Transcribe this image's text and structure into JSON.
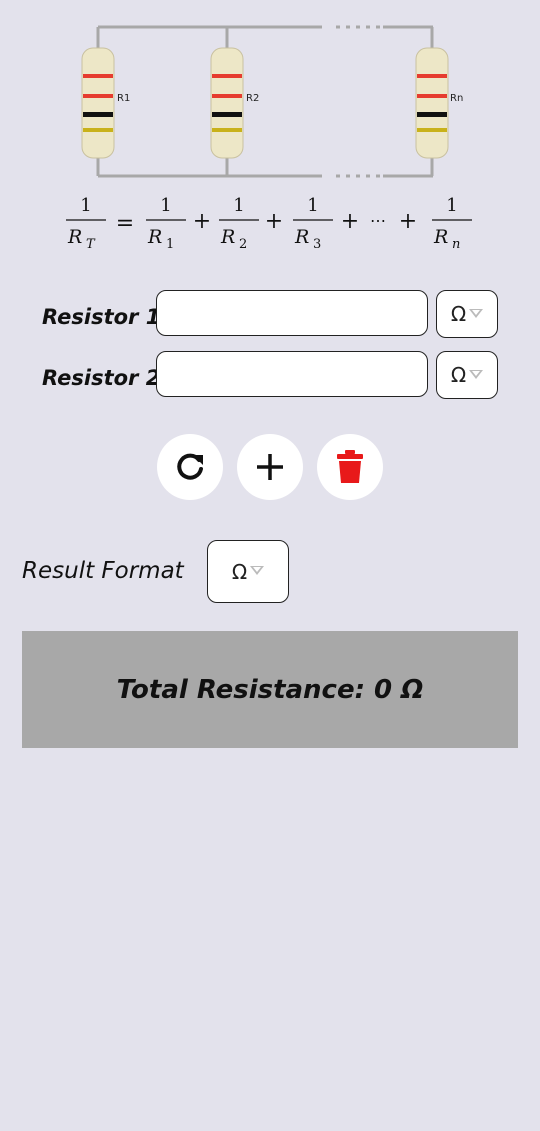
{
  "diagram": {
    "labels": [
      "R1",
      "R2",
      "Rn"
    ],
    "formula": {
      "numerator": "1",
      "lhs_sub": "T",
      "terms_sub": [
        "1",
        "2",
        "3",
        "n"
      ],
      "ellipsis": "⋯"
    }
  },
  "resistors": [
    {
      "label": "Resistor 1:",
      "value": "",
      "unit": "Ω"
    },
    {
      "label": "Resistor 2:",
      "value": "",
      "unit": "Ω"
    }
  ],
  "actions": {
    "reset_icon": "refresh-icon",
    "add_icon": "plus-icon",
    "delete_icon": "trash-icon",
    "delete_color": "#e8191a"
  },
  "result": {
    "format_label": "Result Format",
    "format_unit": "Ω",
    "total_text": "Total Resistance: 0 Ω"
  }
}
